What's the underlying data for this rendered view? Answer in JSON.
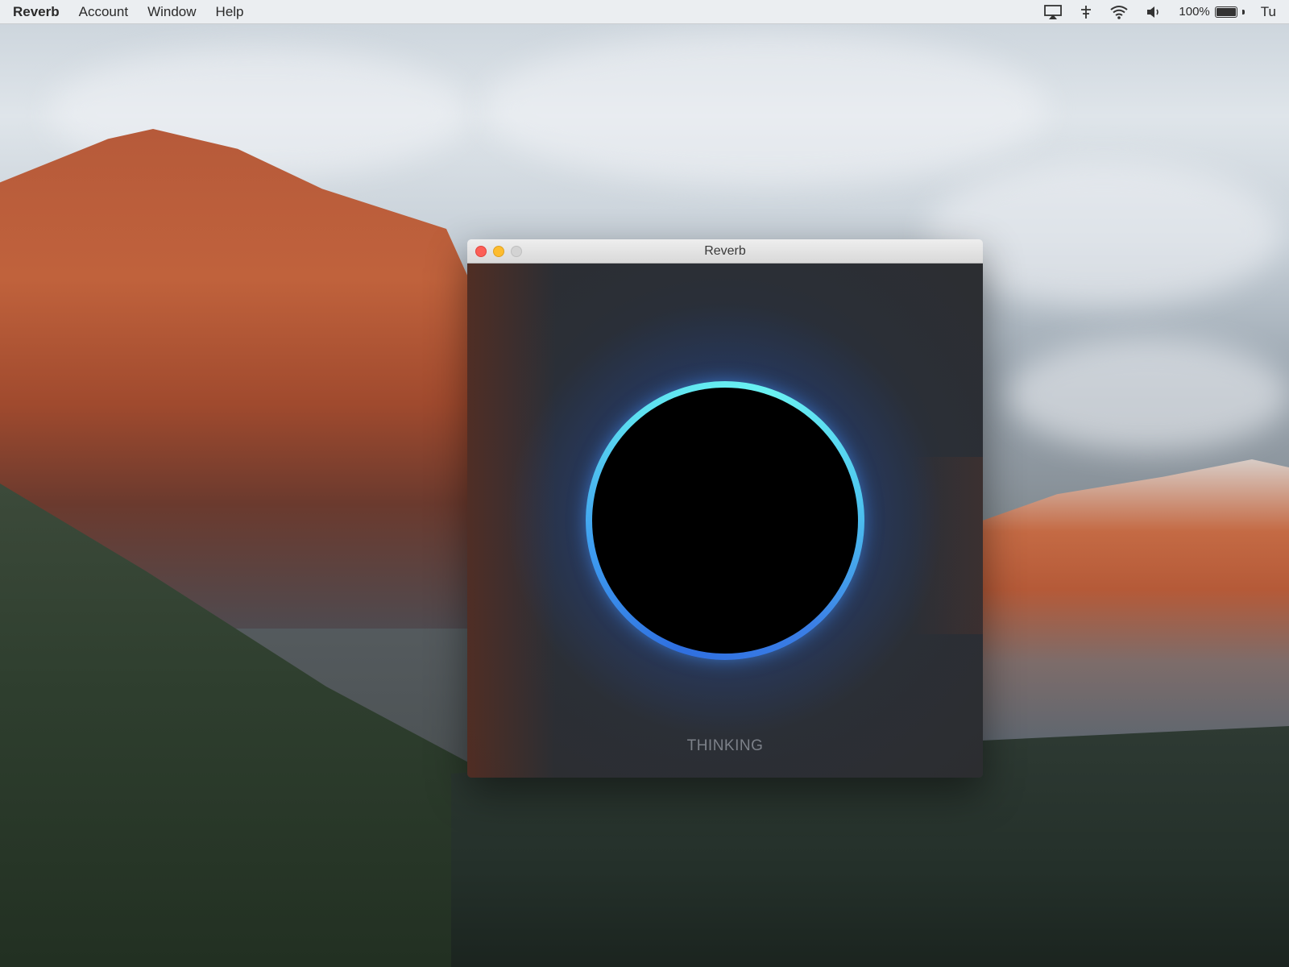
{
  "menubar": {
    "app_name": "Reverb",
    "items": [
      "Account",
      "Window",
      "Help"
    ],
    "status_icons": [
      "airplay-icon",
      "input-icon",
      "wifi-icon",
      "volume-icon"
    ],
    "battery_text": "100%",
    "clock_partial": "Tu"
  },
  "window": {
    "title": "Reverb",
    "status": "THINKING",
    "ring_colors": [
      "#2f6fe0",
      "#5de0f0"
    ],
    "background_color": "#2c2d30"
  }
}
